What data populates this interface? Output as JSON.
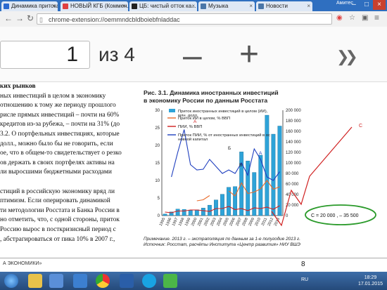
{
  "browser": {
    "tabs": [
      {
        "label": "Динамика притока ..."
      },
      {
        "label": "НОВЫЙ КГБ (Коммен..."
      },
      {
        "label": "ЦБ: чистый отток ка..."
      },
      {
        "label": "Музыка"
      },
      {
        "label": "Новости"
      }
    ],
    "user": "Амитес",
    "address": "chrome-extension://oemmndcbldboiebfnladdac"
  },
  "pdf_toolbar": {
    "page_value": "1",
    "page_of": "из 4",
    "zoom_out": "–",
    "zoom_in": "+"
  },
  "document": {
    "left_lines": [
      "ких рынков",
      "ных инвестиций в целом в экономику",
      "отношению к тому же периоду прошлого",
      "рисле прямых инвестиций – почти на 60%",
      "кредитов из-за рубежа, – почти на 31% (до",
      "3.2. О портфельных инвестициях, которые",
      "долл., можно было бы не говорить, если",
      "ое, что в общем-то свидетельствует о резко",
      "ов держать в своих портфелях активы на",
      "ли выросшими бюджетными расходами",
      "",
      "стиций в российскую экономику вряд ли",
      "птимизм. Если оперировать динамикой",
      "ти методологии Росстата и Банка России в",
      "но отметить, что, с одной стороны, приток",
      "Россию вырос в посткризисный период с",
      ", абстрагироваться от пика 10% в 2007 г.,"
    ],
    "chart_title_1": "Рис. 3.1. Динамика иностранных инвестиций",
    "chart_title_2": "в экономику России по данным Росстата",
    "note_1": "Примечание. 2013 г. – экстраполяция по данным за 1-е полугодие 2013 г.",
    "note_2": "Источник: Росстат, расчёты Института «Центр развития» НИУ ВШЭ",
    "footer_section": "А ЭКОНОМИКИ»",
    "page_number": "8"
  },
  "chart_data": {
    "type": "bar",
    "categories": [
      "1995",
      "1996",
      "1997",
      "1998",
      "1999",
      "2000",
      "2001",
      "2002",
      "2003",
      "2004",
      "2005",
      "2006",
      "2007",
      "2008",
      "2009",
      "2010",
      "2011",
      "2012",
      "2013"
    ],
    "y2lim": [
      0,
      200000
    ],
    "y2ticks": [
      "0",
      "20 000",
      "40 000",
      "60 000",
      "80 000",
      "100 000",
      "120 000",
      "140 000",
      "160 000",
      "180 000",
      "200 000"
    ],
    "ylim": [
      0,
      30
    ],
    "yticks": [
      "0",
      "5",
      "10",
      "15",
      "20",
      "25",
      "30"
    ],
    "series": [
      {
        "name": "Приток иностранных инвестиций в целом (ИИ), млн. долл.",
        "color": "#2ea3d8",
        "axis": "right",
        "values": [
          2900,
          6900,
          12300,
          11800,
          9600,
          11000,
          14300,
          19800,
          29700,
          40500,
          53700,
          55100,
          120900,
          103800,
          81900,
          114700,
          190600,
          154600,
          170000
        ]
      },
      {
        "name": "Приток ИИ в целом, % ВВП",
        "color": "#e86a2a",
        "axis": "left",
        "values": [
          null,
          null,
          null,
          null,
          null,
          4.2,
          4.5,
          5.7,
          null,
          null,
          7.0,
          5.6,
          9.3,
          6.3,
          6.7,
          7.6,
          10.0,
          7.5,
          8.2
        ]
      },
      {
        "name": "ПИИ, % ВВП",
        "color": "#d02020",
        "axis": "left",
        "values": [
          1.0,
          0.8,
          1.3,
          1.3,
          1.6,
          1.6,
          1.4,
          1.2,
          2.0,
          2.0,
          2.6,
          1.7,
          2.0,
          1.4,
          2.2,
          2.0,
          2.4,
          1.8,
          2.8
        ]
      },
      {
        "name": "Приток ПИИ, % от иностранных инвестиций в основной капитал",
        "color": "#1f3fbf",
        "axis": "left",
        "values": [
          null,
          11.0,
          18.0,
          24.5,
          14.5,
          13.0,
          13.2,
          16.0,
          14.0,
          12.0,
          13.0,
          12.0,
          15.0,
          11.5,
          19.0,
          16.0,
          11.0,
          10.0,
          12.5
        ]
      }
    ],
    "annotations": {
      "labels": [
        "А",
        "А",
        "Б",
        "В",
        "С"
      ],
      "equation": "С  =  20 000  ,  – 35 500"
    }
  },
  "taskbar": {
    "lang": "RU",
    "time": "18:29",
    "date": "17.01.2015"
  }
}
